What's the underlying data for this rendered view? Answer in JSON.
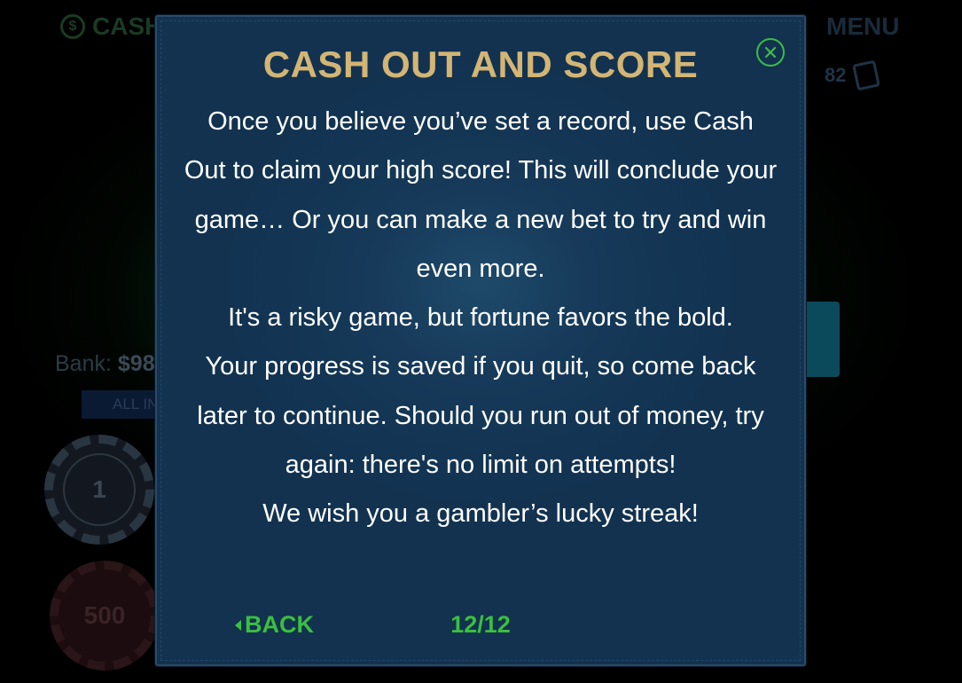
{
  "background": {
    "top_left_label": "CASH",
    "menu_label": "MENU",
    "cards_count": "82",
    "bank_label": "Bank:",
    "bank_value": "$98",
    "all_in_label": "ALL IN",
    "chips": [
      {
        "label": "1"
      },
      {
        "label": "500"
      }
    ]
  },
  "modal": {
    "title": "CASH OUT AND SCORE",
    "paragraphs": [
      "Once you believe you’ve set a record, use Cash Out to claim your high score! This will conclude your game… Or you can make a new bet to try and win even more.",
      "It's a risky game, but fortune favors the bold.",
      "Your progress is saved if you quit, so come back later to continue. Should you run out of money, try again: there's no limit on attempts!",
      "We wish you a gambler’s lucky streak!"
    ],
    "back_label": "BACK",
    "page_indicator": "12/12"
  },
  "colors": {
    "title": "#d3b574",
    "accent_green": "#3bbf3f",
    "modal_bg": "#133553",
    "body_text": "#ffffff"
  },
  "icons": {
    "close": "close-circle-icon",
    "back": "caret-left-icon",
    "cards": "cards-icon",
    "top_left": "info-circle-icon"
  }
}
